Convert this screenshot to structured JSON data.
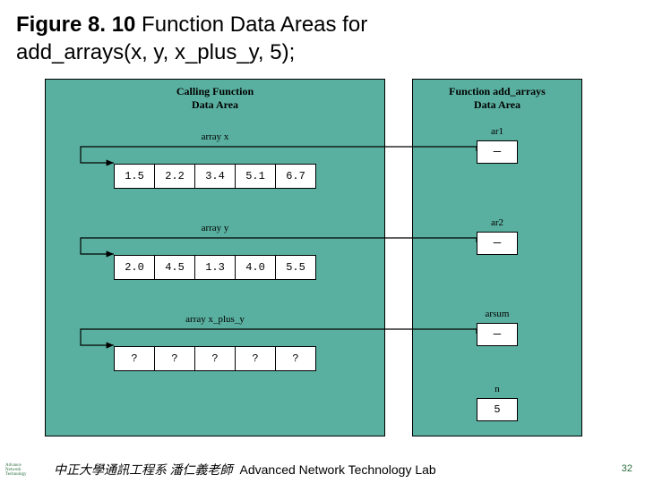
{
  "title": {
    "figure_label": "Figure 8. 10",
    "caption_line1": " Function Data Areas for",
    "caption_line2": "add_arrays(x, y, x_plus_y, 5);"
  },
  "left_panel": {
    "title_l1": "Calling Function",
    "title_l2": "Data Area",
    "arrays": {
      "x": {
        "label": "array x",
        "cells": [
          "1.5",
          "2.2",
          "3.4",
          "5.1",
          "6.7"
        ]
      },
      "y": {
        "label": "array y",
        "cells": [
          "2.0",
          "4.5",
          "1.3",
          "4.0",
          "5.5"
        ]
      },
      "xpy": {
        "label": "array x_plus_y",
        "cells": [
          "?",
          "?",
          "?",
          "?",
          "?"
        ]
      }
    }
  },
  "right_panel": {
    "title_l1": "Function add_arrays",
    "title_l2": "Data Area",
    "ptrs": {
      "ar1": "ar1",
      "ar2": "ar2",
      "arsum": "arsum"
    },
    "n_label": "n",
    "n_value": "5"
  },
  "footer": {
    "logo_l1": "Advance",
    "logo_l2": "Network",
    "logo_l3": "Technology",
    "cn": "中正大學通訊工程系 潘仁義老師",
    "lab": "Advanced Network Technology Lab",
    "page": "32"
  },
  "chart_data": {
    "type": "table",
    "title": "Function Data Areas for add_arrays(x, y, x_plus_y, 5)",
    "calling_function": {
      "array_x": [
        1.5,
        2.2,
        3.4,
        5.1,
        6.7
      ],
      "array_y": [
        2.0,
        4.5,
        1.3,
        4.0,
        5.5
      ],
      "array_x_plus_y": [
        "?",
        "?",
        "?",
        "?",
        "?"
      ]
    },
    "function_add_arrays": {
      "ar1": "pointer -> array_x[0]",
      "ar2": "pointer -> array_y[0]",
      "arsum": "pointer -> array_x_plus_y[0]",
      "n": 5
    }
  }
}
